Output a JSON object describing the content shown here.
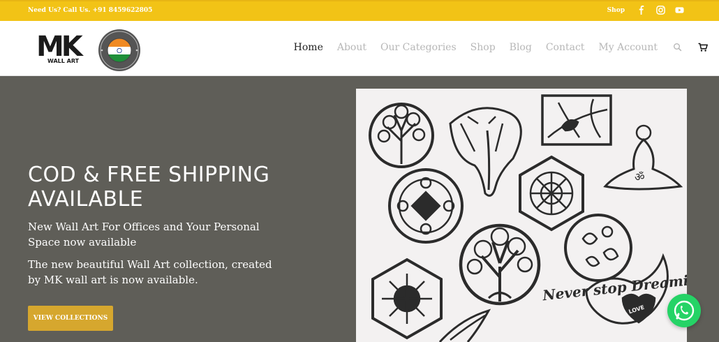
{
  "topbar": {
    "call_text": "Need Us? Call Us. +91 8459622805",
    "shop_label": "Shop",
    "social_icons": [
      "facebook-icon",
      "instagram-icon",
      "youtube-icon"
    ]
  },
  "header": {
    "logo_text": "MK",
    "logo_subtext": "WALL ART",
    "seal_text": "MADE IN INDIA",
    "nav": [
      "Home",
      "About",
      "Our Categories",
      "Shop",
      "Blog",
      "Contact",
      "My Account"
    ],
    "active_nav": "Home",
    "icons": [
      "search-icon",
      "cart-icon"
    ]
  },
  "hero": {
    "headline": "COD & FREE SHIPPING AVAILABLE",
    "para1": "New Wall Art For Offices and Your Personal Space now available",
    "para2": "The new beautiful Wall Art collection, created by MK wall art is now available.",
    "button_label": "VIEW COLLECTIONS",
    "art_caption": "Never stop Dreaming",
    "art_love": "LOVE"
  },
  "whatsapp": {
    "icon": "whatsapp-icon"
  },
  "colors": {
    "topbar": "#f2c316",
    "hero_bg": "#5f5e58",
    "button": "#d6a72e",
    "whatsapp": "#25d366"
  }
}
